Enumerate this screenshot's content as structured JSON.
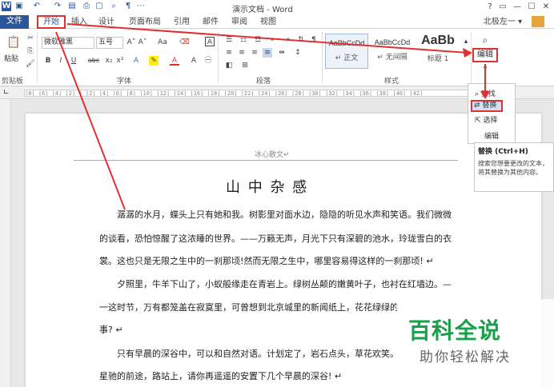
{
  "window": {
    "title": "演示文档 - Word",
    "user": "北极左一 ▾",
    "controls": [
      "?",
      "▭",
      "—",
      "☐",
      "✕"
    ]
  },
  "tabs": [
    "文件",
    "开始",
    "插入",
    "设计",
    "页面布局",
    "引用",
    "邮件",
    "审阅",
    "视图"
  ],
  "ribbon": {
    "clipboard": {
      "paste": "粘贴",
      "label": "剪贴板"
    },
    "font": {
      "name": "微软雅黑",
      "size": "五号",
      "grow": "A˄",
      "shrink": "A˅",
      "case": "Aa",
      "bold": "B",
      "italic": "I",
      "underline": "U",
      "strike": "abc",
      "sub": "x₂",
      "sup": "x²",
      "label": "字体"
    },
    "paragraph": {
      "label": "段落"
    },
    "styles": {
      "items": [
        {
          "sample": "AaBbCcDd",
          "name": "↵ 正文"
        },
        {
          "sample": "AaBbCcDd",
          "name": "↵ 无间隔"
        },
        {
          "sample": "AaBb",
          "name": "标题 1"
        }
      ],
      "label": "样式"
    },
    "editing": {
      "label": "编辑"
    }
  },
  "ruler": "|8| |6| |4| |2| | |2| |4| |6| |8| |10| |12| |14| |16| |18| |20| |22| |24| |26| |28| |30| |32| |34| |36| |38| |40| |42|",
  "edit_menu": {
    "find": "查找",
    "replace": "替换",
    "select": "选择",
    "label": "编辑"
  },
  "tooltip": {
    "title": "替换 (Ctrl+H)",
    "body": "搜索您想要更改的文本，将其替换为其他内容。"
  },
  "document": {
    "header": "冰心散文↵",
    "title": "山 中 杂 感",
    "lines": [
      "潺潺的水月，蝶头上只有她和我。树影里对面水边，隐隐的听见水声和笑语。我们微微",
      "的谈看，恐怕惊醒了这浓睡的世界。——万籁无声，月光下只有深碧的池水，玲珑雪白的衣",
      "裳。这也只是无限之生中的一刹那顷!然而无限之生中，哪里容易得这样的一刹那顷! ↵",
      "夕照里，牛羊下山了，小蚁般缘走在青岩上。绿树丛颠的嫩黄叶子，也衬在红墙边。—",
      "一这时节，万有都笼盖在寂寞里，可曾想到北京城里的新闻纸上，花花绿绿的",
      "事? ↵",
      "只有早晨的深谷中，可以和自然对语。计划定了，岩石点头，草花欢笑。",
      "星驰的前途，路站上，请你再遥遥的安置下几个早晨的深谷! ↵"
    ]
  },
  "watermark": {
    "title": "百科全说",
    "subtitle": "助你轻松解决"
  },
  "colors": {
    "accent": "#2b579a",
    "highlight": "#e03030",
    "brand": "#1aa04b"
  }
}
